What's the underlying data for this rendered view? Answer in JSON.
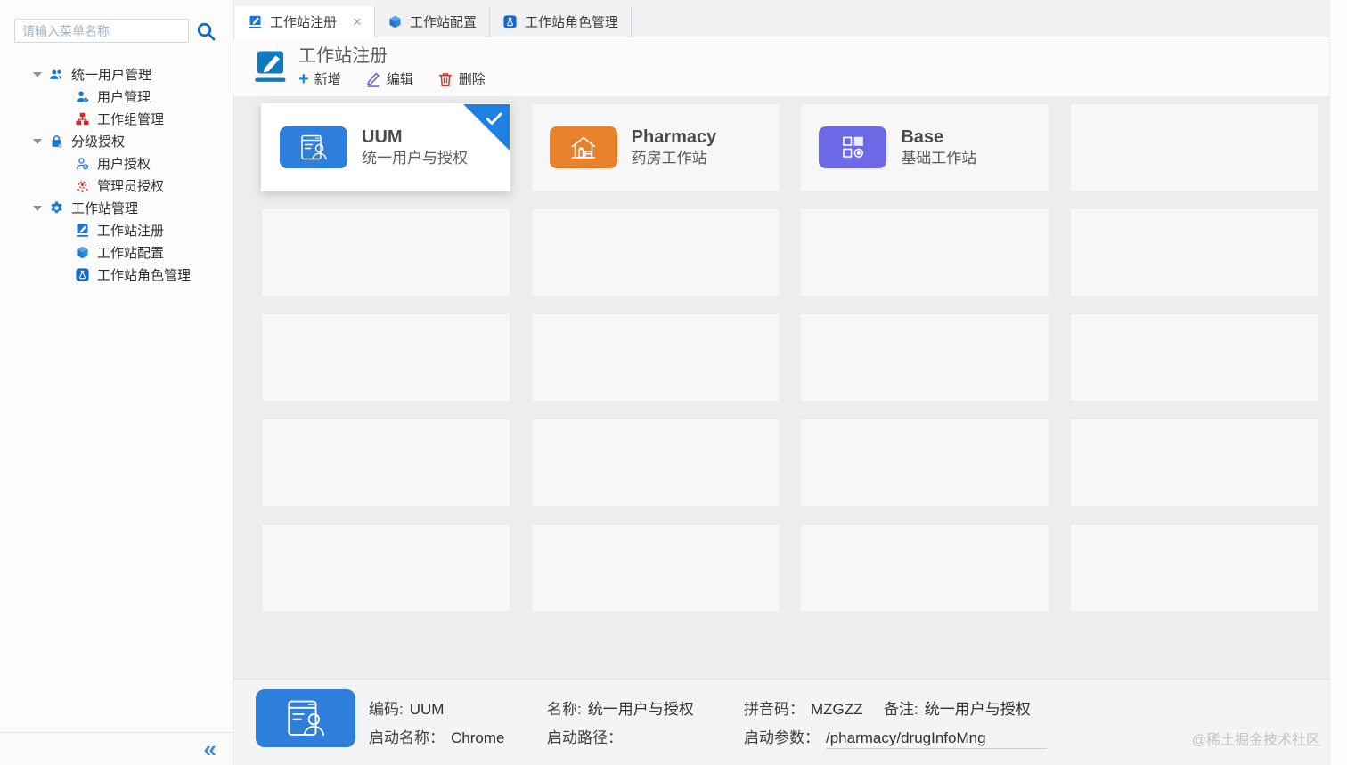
{
  "app": {
    "watermark": "@稀土掘金技术社区"
  },
  "icons": {
    "close": "×",
    "collapse": "«",
    "plus": "+"
  },
  "colors": {
    "primary_blue": "#1a78d2",
    "selected_blue": "#1e80e2",
    "card_blue": "#2e7fdc",
    "pharmacy_orange": "#e8822c",
    "base_indigo": "#6c69e6",
    "danger_red": "#d23b33",
    "edit_purple": "#6f5ec9",
    "sitemap_red": "#cf2b2b"
  },
  "sidebar": {
    "search_placeholder": "请输入菜单名称",
    "tree": [
      {
        "label": "统一用户管理",
        "children": [
          {
            "label": "用户管理"
          },
          {
            "label": "工作组管理"
          }
        ]
      },
      {
        "label": "分级授权",
        "children": [
          {
            "label": "用户授权"
          },
          {
            "label": "管理员授权"
          }
        ]
      },
      {
        "label": "工作站管理",
        "children": [
          {
            "label": "工作站注册"
          },
          {
            "label": "工作站配置"
          },
          {
            "label": "工作站角色管理"
          }
        ]
      }
    ]
  },
  "tabs": [
    {
      "label": "工作站注册",
      "active": true,
      "closable": true
    },
    {
      "label": "工作站配置",
      "active": false
    },
    {
      "label": "工作站角色管理",
      "active": false
    }
  ],
  "header": {
    "title": "工作站注册",
    "actions": {
      "add": "新增",
      "edit": "编辑",
      "delete": "删除"
    }
  },
  "cards": [
    {
      "code": "UUM",
      "name": "统一用户与授权",
      "selected": true
    },
    {
      "code": "Pharmacy",
      "name": "药房工作站",
      "selected": false
    },
    {
      "code": "Base",
      "name": "基础工作站",
      "selected": false
    }
  ],
  "empty_slots": 17,
  "details": {
    "fields": [
      {
        "label": "编码:",
        "value": "UUM"
      },
      {
        "label": "名称:",
        "value": "统一用户与授权"
      },
      {
        "label": "拼音码：",
        "value": "MZGZZ"
      },
      {
        "label": "备注:",
        "value": "统一用户与授权"
      },
      {
        "label": "启动名称：",
        "value": "Chrome"
      },
      {
        "label": "启动路径：",
        "value": ""
      },
      {
        "label": "启动参数：",
        "value": "/pharmacy/drugInfoMng"
      }
    ]
  }
}
